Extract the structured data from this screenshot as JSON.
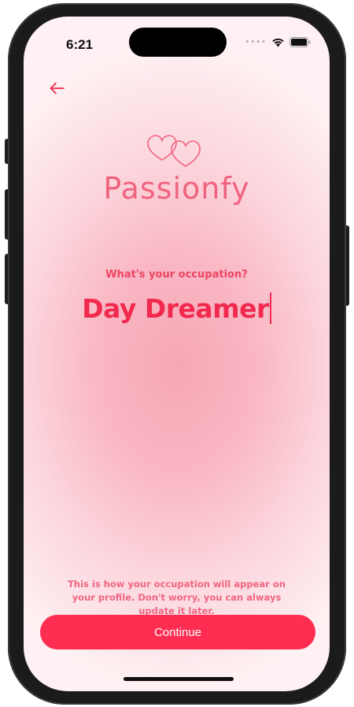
{
  "status_bar": {
    "time": "6:21",
    "signal_icon": "signal-dots-icon",
    "wifi_icon": "wifi-icon",
    "battery_icon": "battery-icon"
  },
  "header": {
    "back_icon": "arrow-left-icon"
  },
  "brand": {
    "logo_icon": "two-hearts-icon",
    "name": "Passionfy"
  },
  "form": {
    "question": "What's your occupation?",
    "value": "Day Dreamer"
  },
  "footer": {
    "helper_text": "This is how your occupation will appear on your profile. Don't worry, you can always update it later.",
    "continue_label": "Continue"
  },
  "colors": {
    "accent": "#ff2d51",
    "brand_pink": "#f0637e",
    "answer_text": "#f2294e"
  }
}
